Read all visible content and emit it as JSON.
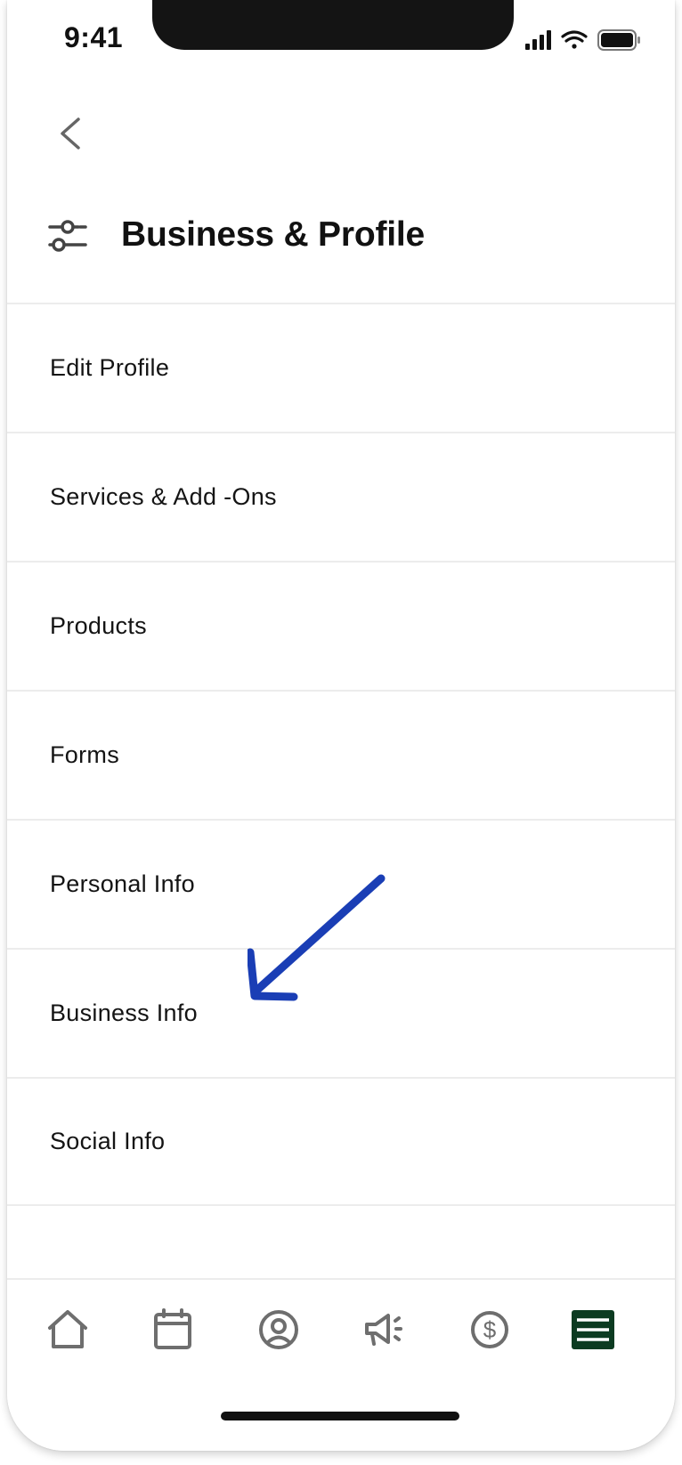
{
  "status_bar": {
    "time": "9:41"
  },
  "header": {
    "title": "Business & Profile",
    "icon": "sliders-icon",
    "back_icon": "chevron-left-icon"
  },
  "menu": {
    "items": [
      {
        "label": "Edit Profile"
      },
      {
        "label": "Services & Add -Ons"
      },
      {
        "label": "Products"
      },
      {
        "label": "Forms"
      },
      {
        "label": "Personal Info"
      },
      {
        "label": "Business Info"
      },
      {
        "label": "Social Info"
      }
    ]
  },
  "annotation": {
    "type": "arrow",
    "points_to": "Business Info",
    "color": "#1a3eb5"
  },
  "tabbar": {
    "tabs": [
      {
        "icon": "home-icon",
        "active": false
      },
      {
        "icon": "calendar-icon",
        "active": false
      },
      {
        "icon": "user-circle-icon",
        "active": false
      },
      {
        "icon": "megaphone-icon",
        "active": false
      },
      {
        "icon": "dollar-icon",
        "active": false
      },
      {
        "icon": "menu-icon",
        "active": true
      }
    ],
    "active_color": "#0c3b21",
    "inactive_color": "#6e6e6e"
  }
}
